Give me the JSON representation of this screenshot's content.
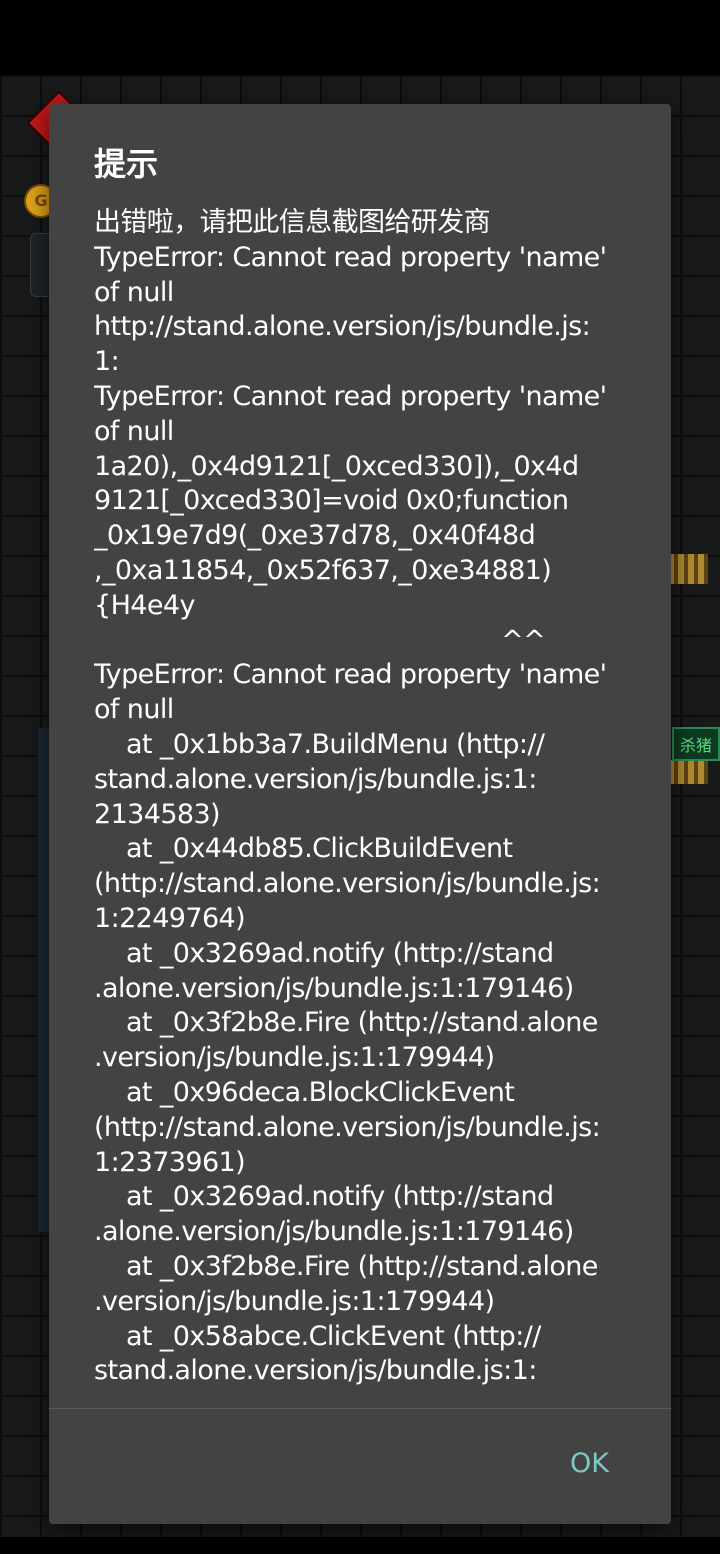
{
  "background": {
    "coin_label": "G",
    "sign_label": "杀猪"
  },
  "dialog": {
    "title": "提示",
    "message": "出错啦，请把此信息截图给研发商\nTypeError: Cannot read property 'name'\nof null\nhttp://stand.alone.version/js/bundle.js:\n1:\nTypeError: Cannot read property 'name'\nof null\n1a20),_0x4d9121[_0xced330]),_0x4d\n9121[_0xced330]=void 0x0;function\n_0x19e7d9(_0xe37d78,_0x40f48d\n,_0xa11854,_0x52f637,_0xe34881)\n{H4e4y\n                                                   ^^\nTypeError: Cannot read property 'name'\nof null\n    at _0x1bb3a7.BuildMenu (http://\nstand.alone.version/js/bundle.js:1:\n2134583)\n    at _0x44db85.ClickBuildEvent\n(http://stand.alone.version/js/bundle.js:\n1:2249764)\n    at _0x3269ad.notify (http://stand\n.alone.version/js/bundle.js:1:179146)\n    at _0x3f2b8e.Fire (http://stand.alone\n.version/js/bundle.js:1:179944)\n    at _0x96deca.BlockClickEvent\n(http://stand.alone.version/js/bundle.js:\n1:2373961)\n    at _0x3269ad.notify (http://stand\n.alone.version/js/bundle.js:1:179146)\n    at _0x3f2b8e.Fire (http://stand.alone\n.version/js/bundle.js:1:179944)\n    at _0x58abce.ClickEvent (http://\nstand.alone.version/js/bundle.js:1:",
    "ok_label": "OK"
  },
  "colors": {
    "dialog_bg": "#434343",
    "accent": "#7cc9c2",
    "text": "#ffffff"
  }
}
